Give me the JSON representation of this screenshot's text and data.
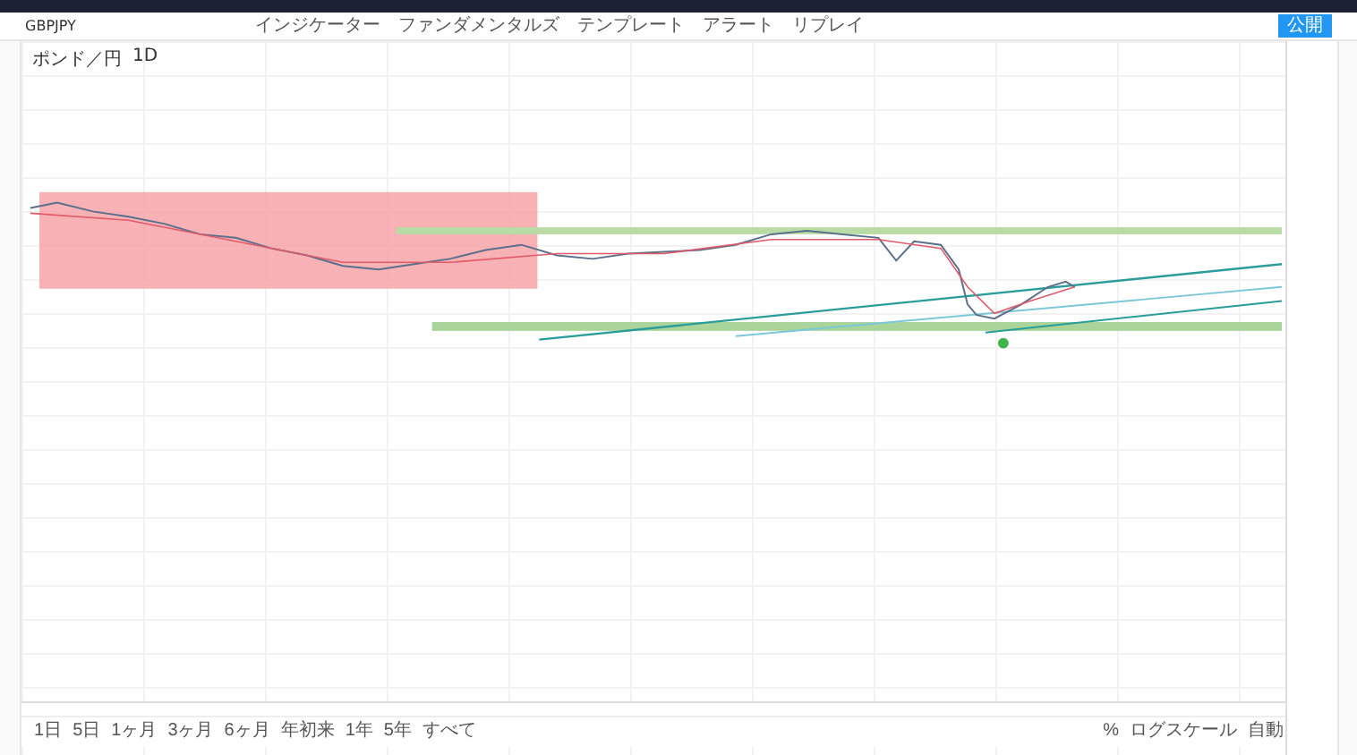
{
  "toolbar": {
    "symbol": "GBPJPY",
    "items": [
      "インジケーター",
      "ファンダメンタルズ",
      "テンプレート",
      "アラート",
      "リプレイ"
    ],
    "publish": "公開"
  },
  "legend": {
    "title": "ポンド／円",
    "interval": "1D"
  },
  "bottom_bar": {
    "ranges": [
      {
        "label": "1日",
        "selected": false
      },
      {
        "label": "5日",
        "selected": false
      },
      {
        "label": "1ヶ月",
        "selected": false
      },
      {
        "label": "3ヶ月",
        "selected": false
      },
      {
        "label": "6ヶ月",
        "selected": false
      },
      {
        "label": "年初来",
        "selected": false
      },
      {
        "label": "1年",
        "selected": false
      },
      {
        "label": "5年",
        "selected": false
      },
      {
        "label": "すべて",
        "selected": false
      }
    ],
    "right": [
      "%",
      "ログスケール",
      "自動"
    ]
  }
}
